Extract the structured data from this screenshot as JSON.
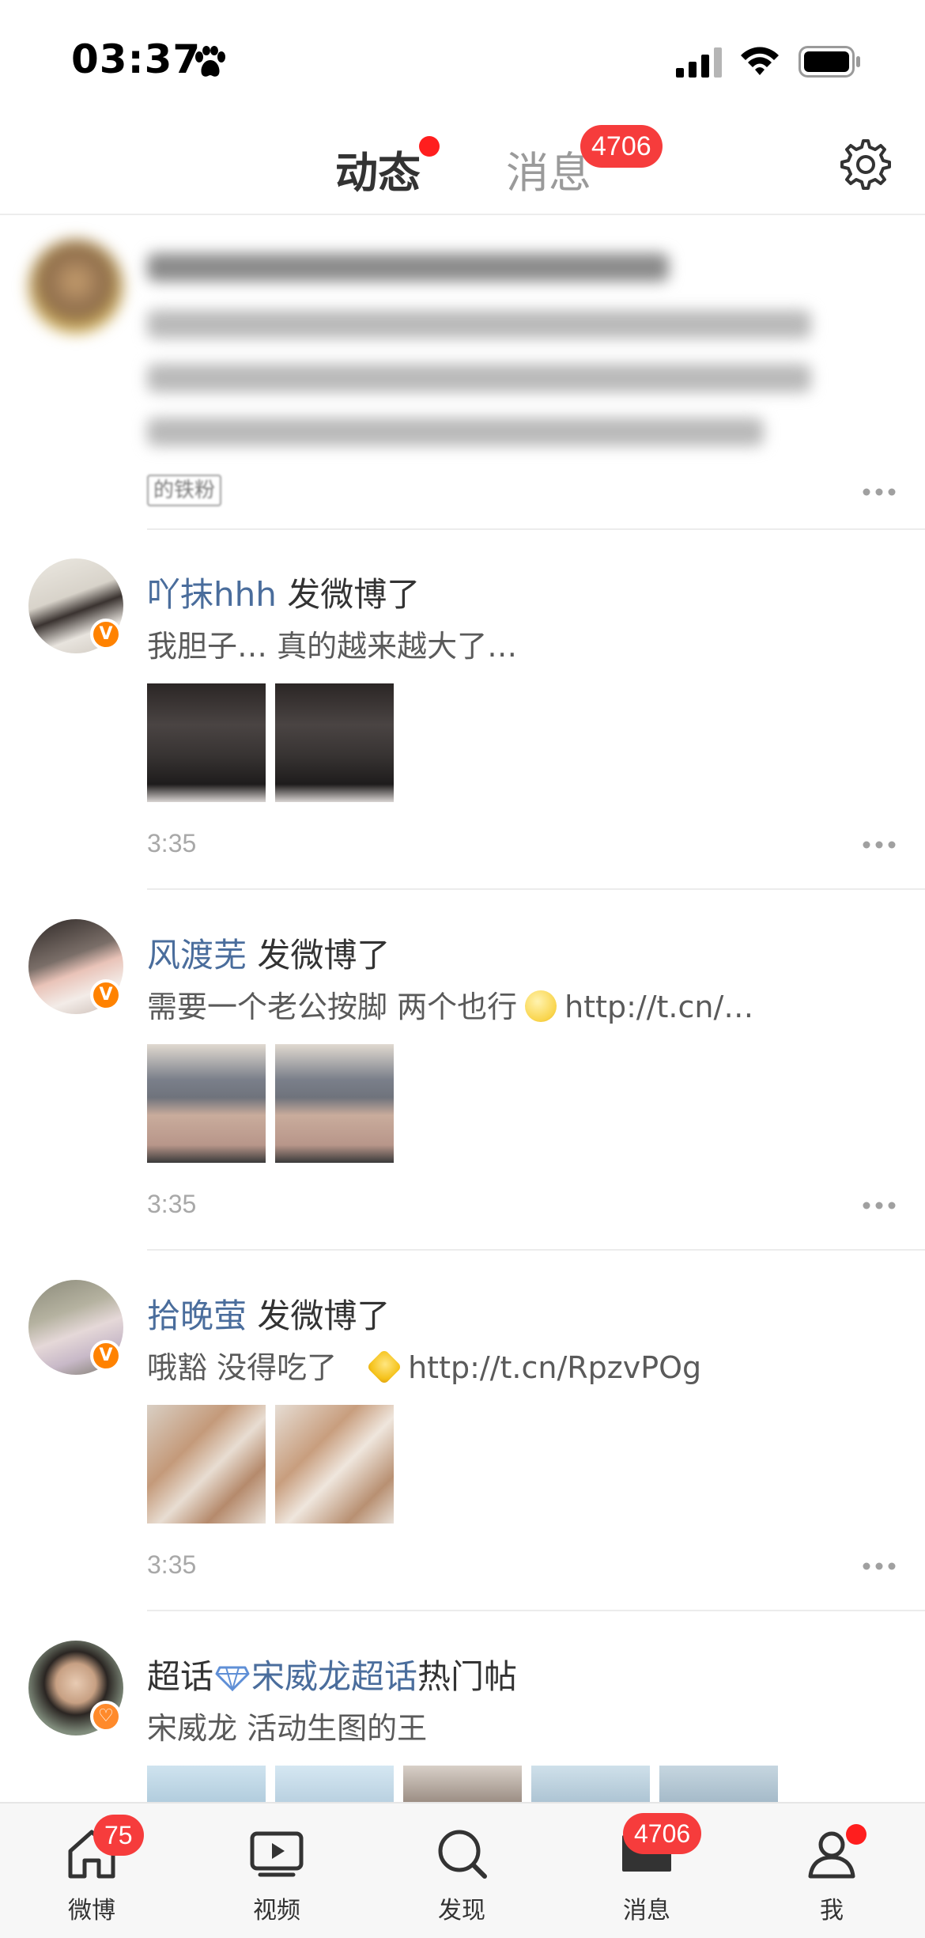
{
  "status_bar": {
    "time": "03:37"
  },
  "header": {
    "tab_active": "动态",
    "tab_inactive": "消息",
    "messages_badge": "4706"
  },
  "posts": [
    {
      "blurred": true,
      "fan_tag": "的铁粉"
    },
    {
      "username": "吖抹hhh",
      "action": " 发微博了",
      "text": "我胆子… 真的越来越大了…",
      "time": "3:35"
    },
    {
      "username": "风渡芜",
      "action": " 发微博了",
      "text_before": "需要一个老公按脚 两个也行",
      "text_after": "http://t.cn/…",
      "time": "3:35"
    },
    {
      "username": "拾晚萤",
      "action": " 发微博了",
      "text_before": "哦豁 没得吃了",
      "text_after": "http://t.cn/RpzvPOg",
      "time": "3:35"
    },
    {
      "prefix": "超话",
      "username": "宋威龙超话",
      "action": "热门帖",
      "text": "宋威龙 活动生图的王"
    }
  ],
  "bottom_nav": {
    "items": [
      {
        "label": "微博",
        "badge": "75"
      },
      {
        "label": "视频"
      },
      {
        "label": "发现"
      },
      {
        "label": "消息",
        "badge": "4706"
      },
      {
        "label": "我"
      }
    ]
  },
  "colors": {
    "accent": "#ff8200",
    "badge": "#f63c3c",
    "username": "#4a6d9c"
  }
}
